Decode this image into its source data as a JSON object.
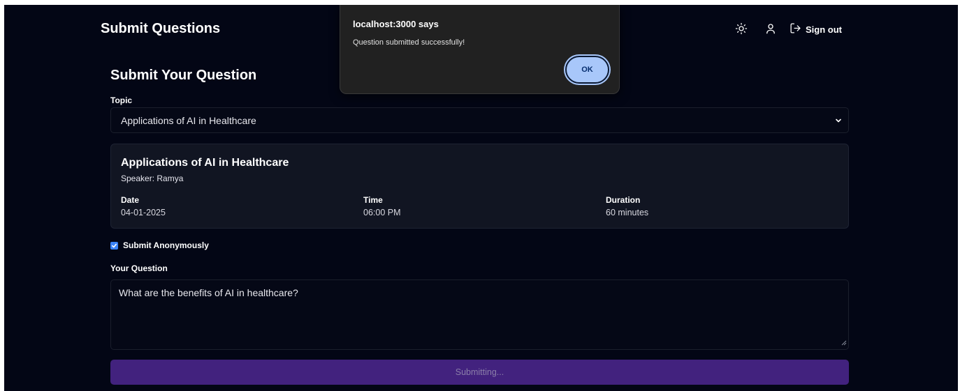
{
  "header": {
    "title": "Submit Questions",
    "theme_toggle_icon": "sun-icon",
    "profile_icon": "user-icon",
    "sign_out_label": "Sign out",
    "sign_out_icon": "sign-out-icon"
  },
  "form": {
    "page_title": "Submit Your Question",
    "topic_label": "Topic",
    "topic_selected": "Applications of AI in Healthcare",
    "session": {
      "title": "Applications of AI in Healthcare",
      "speaker": "Speaker: Ramya",
      "date_label": "Date",
      "date_value": "04-01-2025",
      "time_label": "Time",
      "time_value": "06:00 PM",
      "duration_label": "Duration",
      "duration_value": "60 minutes"
    },
    "anonymous_label": "Submit Anonymously",
    "anonymous_checked": true,
    "question_label": "Your Question",
    "question_value": "What are the benefits of AI in healthcare?",
    "submit_label": "Submitting..."
  },
  "dialog": {
    "origin": "localhost:3000 says",
    "message": "Question submitted successfully!",
    "ok_label": "OK"
  },
  "colors": {
    "background": "#030615",
    "card": "#111522",
    "submit_button": "#42227e",
    "checkbox": "#3b82f6",
    "dialog_background": "#212121",
    "dialog_button": "#a8c7fa"
  }
}
